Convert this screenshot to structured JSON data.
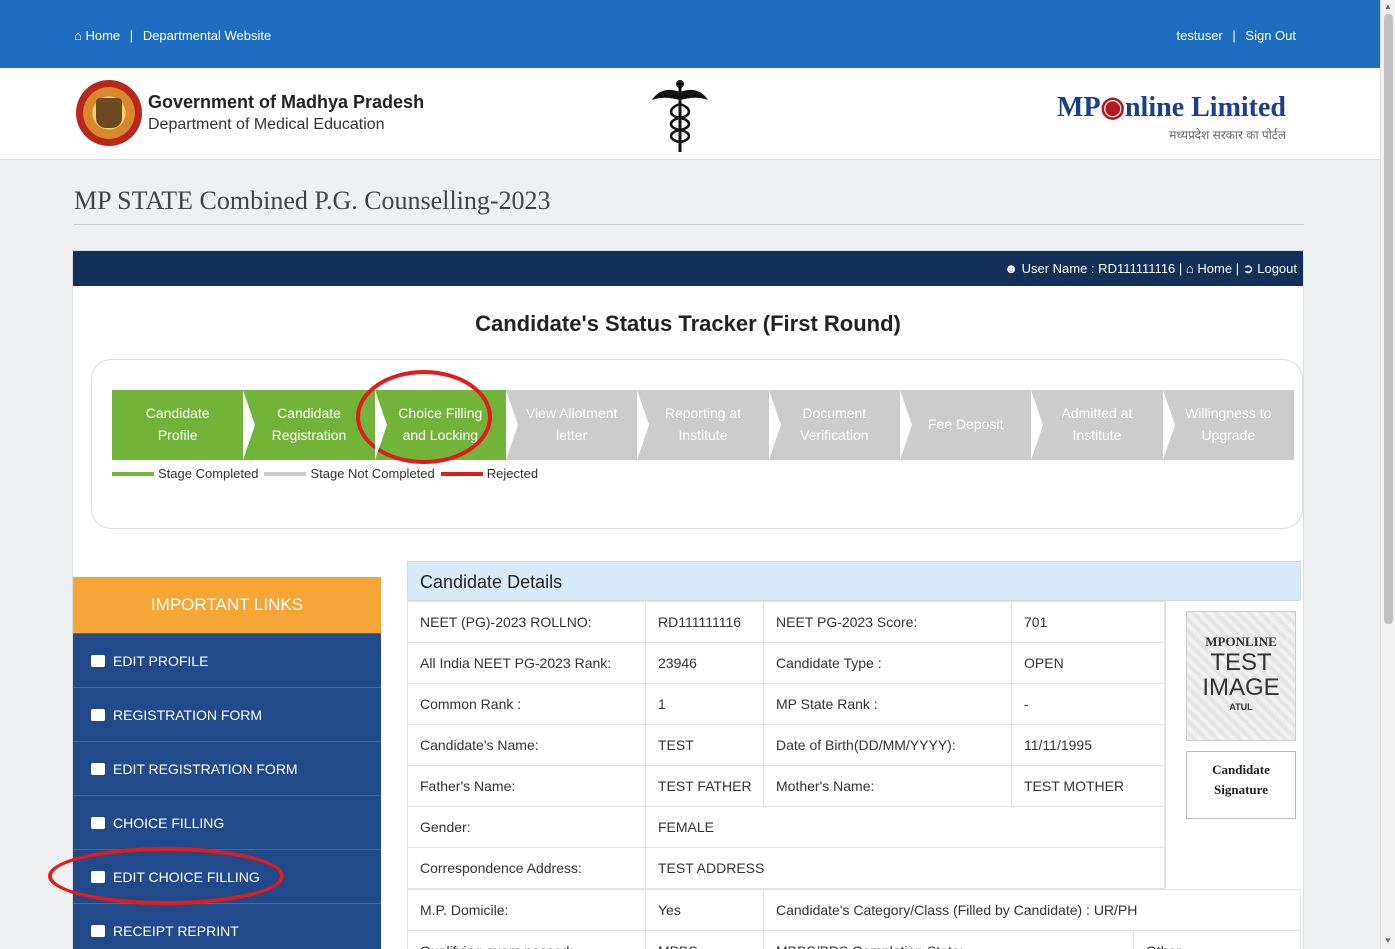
{
  "topbar": {
    "home": "Home",
    "departmental": "Departmental Website",
    "user": "testuser",
    "signout": "Sign Out"
  },
  "header": {
    "gov_title": "Government of Madhya Pradesh",
    "gov_sub": "Department of Medical Education",
    "brand_mp": "MP",
    "brand_online": "nline Limited",
    "brand_tag": "मध्यप्रदेश सरकार का पोर्टल"
  },
  "page_title": "MP STATE Combined P.G. Counselling-2023",
  "panel_bar": {
    "user": "User Name : RD111111116",
    "home": "Home",
    "logout": "Logout"
  },
  "tracker": {
    "title": "Candidate's Status Tracker (First Round)",
    "steps": [
      {
        "label": "Candidate Profile",
        "status": "completed"
      },
      {
        "label": "Candidate Registration",
        "status": "completed"
      },
      {
        "label": "Choice Filling and Locking",
        "status": "completed"
      },
      {
        "label": "View Allotment letter",
        "status": "not-completed"
      },
      {
        "label": "Reporting at Institute",
        "status": "not-completed"
      },
      {
        "label": "Document Verification",
        "status": "not-completed"
      },
      {
        "label": "Fee Deposit",
        "status": "not-completed"
      },
      {
        "label": "Admitted at Institute",
        "status": "not-completed"
      },
      {
        "label": "Willingness to Upgrade",
        "status": "not-completed"
      }
    ],
    "legend": {
      "completed": "Stage Completed",
      "not_completed": "Stage Not Completed",
      "rejected": "Rejected"
    }
  },
  "links": {
    "title": "IMPORTANT LINKS",
    "items": [
      "EDIT PROFILE",
      "REGISTRATION FORM",
      "EDIT REGISTRATION FORM",
      "CHOICE FILLING",
      "EDIT CHOICE FILLING",
      "RECEIPT REPRINT"
    ]
  },
  "details": {
    "title": "Candidate Details",
    "rows": [
      [
        "NEET (PG)-2023 ROLLNO:",
        "RD111111116",
        "NEET PG-2023 Score:",
        "701"
      ],
      [
        "All India NEET PG-2023 Rank:",
        "23946",
        "Candidate Type :",
        "OPEN"
      ],
      [
        "Common Rank :",
        "1",
        "MP State Rank :",
        "-"
      ],
      [
        "Candidate's Name:",
        "TEST",
        "Date of Birth(DD/MM/YYYY):",
        "11/11/1995"
      ],
      [
        "Father's Name:",
        "TEST FATHER",
        "Mother's Name:",
        "TEST MOTHER"
      ],
      [
        "Gender:",
        "FEMALE"
      ],
      [
        "Correspondence Address:",
        "TEST ADDRESS"
      ],
      [
        "M.P. Domicile:",
        "Yes",
        "Candidate's Category/Class (Filled by Candidate) : UR/PH"
      ],
      [
        "Qualifying exam passed:",
        "MBBS",
        "MBBS/BDS Completion State:",
        "Other"
      ]
    ],
    "photo": {
      "line1": "MPONLINE",
      "line2": "TEST",
      "line3": "IMAGE",
      "line4": "ATUL"
    },
    "signature": {
      "line1": "Candidate",
      "line2": "Signature"
    }
  },
  "colors": {
    "topbar": "#1e6cc0",
    "completed": "#72b33a",
    "not_completed": "#cccccc",
    "rejected": "#e31b1b",
    "links_head": "#f6a637",
    "links_bg": "#204a8a"
  }
}
